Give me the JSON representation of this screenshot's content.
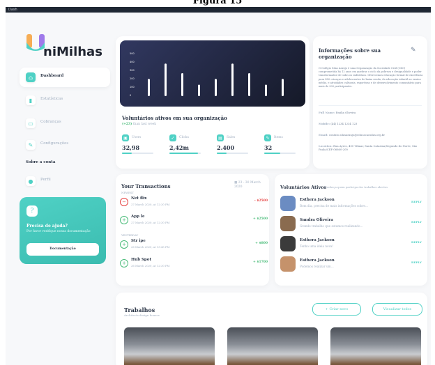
{
  "caption": "Figura 15",
  "window": {
    "title": "Dash"
  },
  "brand": {
    "logo_text": "niMilhas",
    "accent": "#4fd1c5"
  },
  "nav": {
    "items": [
      {
        "label": "Dashboard",
        "icon": "home-icon",
        "active": true
      },
      {
        "label": "Estatísticas",
        "icon": "chart-icon",
        "active": false
      },
      {
        "label": "Cobranças",
        "icon": "card-icon",
        "active": false
      },
      {
        "label": "Configurações",
        "icon": "wrench-icon",
        "active": false
      }
    ],
    "section_label": "Sobre a conta",
    "account_items": [
      {
        "label": "Perfil",
        "icon": "user-icon"
      }
    ]
  },
  "help": {
    "title": "Precisa de ajuda?",
    "subtitle": "Por favor verifique nossa documentação",
    "button": "Documentação",
    "icon": "question-icon"
  },
  "stats": {
    "title": "Voluntários ativos em sua organização",
    "growth": "(+23)",
    "growth_suffix": "than last week",
    "chart_y_ticks": [
      "500",
      "400",
      "300",
      "200",
      "100",
      "0"
    ],
    "kpis": [
      {
        "label": "Users",
        "value": "32,98",
        "icon": "wallet-icon",
        "progress": 0.3
      },
      {
        "label": "Clicks",
        "value": "2,42m",
        "icon": "rocket-icon",
        "progress": 0.9
      },
      {
        "label": "Sales",
        "value": "2.400",
        "icon": "cart-icon",
        "progress": 0.3
      },
      {
        "label": "Items",
        "value": "32",
        "icon": "wrench-icon",
        "progress": 0.5
      }
    ]
  },
  "info": {
    "title": "Informações sobre sua organização",
    "body": "O Colégio Silas Araújo é uma Organização da Sociedade Civil (OSC) comprometida há 12 anos em quebrar o ciclo da pobreza e desigualdade e poder transformador de todos os indivíduos. Oferecemos educação formal de excelência para 450 crianças e adolescentes de baixa renda, da educação infantil ao ensino médio, e atividades culturais, esportivas e de desenvolvimento comunitário para mais de 300 participantes.",
    "fields": [
      {
        "key": "Full Name:",
        "value": "Emilia Oliveira"
      },
      {
        "key": "Mobile:",
        "value": "(44) 1234 1234 123"
      },
      {
        "key": "Email:",
        "value": "contato.silasaraujo@educacaosilas.org.br"
      },
      {
        "key": "Location:",
        "value": "Rua Ayres, 400 Vilmar, Santa Catarina/Segundo do Norte, São Paulo/CEP 06660-200"
      }
    ]
  },
  "transactions": {
    "title": "Your Transactions",
    "date_range": "23 - 30 March 2020",
    "group_label": "NEWEST",
    "group_label_2": "YESTERDAY",
    "rows": [
      {
        "name": "Net flix",
        "time": "27 March 2020, at 12:30 PM",
        "amount": "- $2500",
        "type": "out"
      },
      {
        "name": "App le",
        "time": "27 March 2020, at 12:30 PM",
        "amount": "+ $2500",
        "type": "in"
      },
      {
        "name": "Str ipe",
        "time": "26 March 2020, at 13:45 PM",
        "amount": "+ $800",
        "type": "in"
      },
      {
        "name": "Hub Spot",
        "time": "26 March 2020, at 12:30 PM",
        "amount": "+ $1700",
        "type": "in"
      }
    ]
  },
  "volunteers": {
    "title": "Voluntários Ativos",
    "subtitle": "Conheça quem participa dos trabalhos abertos",
    "rows": [
      {
        "name": "Esthera Jackson",
        "message": "Bom dia, precisa de mais informações sobre...",
        "reply": "REPLY",
        "avatar_color": "#6b8cc2"
      },
      {
        "name": "Sandra Oliveira",
        "message": "Grande trabalho que estamos realizando...",
        "reply": "REPLY",
        "avatar_color": "#8a6b4f"
      },
      {
        "name": "Esthera Jackson",
        "message": "Tenho uma ideia nova!",
        "reply": "REPLY",
        "avatar_color": "#3b3b3b"
      },
      {
        "name": "Esthera Jackson",
        "message": "Podemos realizar um...",
        "reply": "REPLY",
        "avatar_color": "#c5926b"
      }
    ]
  },
  "work": {
    "title": "Trabalhos",
    "subtitle": "Architects design houses",
    "create_button": "Criar novo",
    "view_button": "Visualizar todos"
  }
}
